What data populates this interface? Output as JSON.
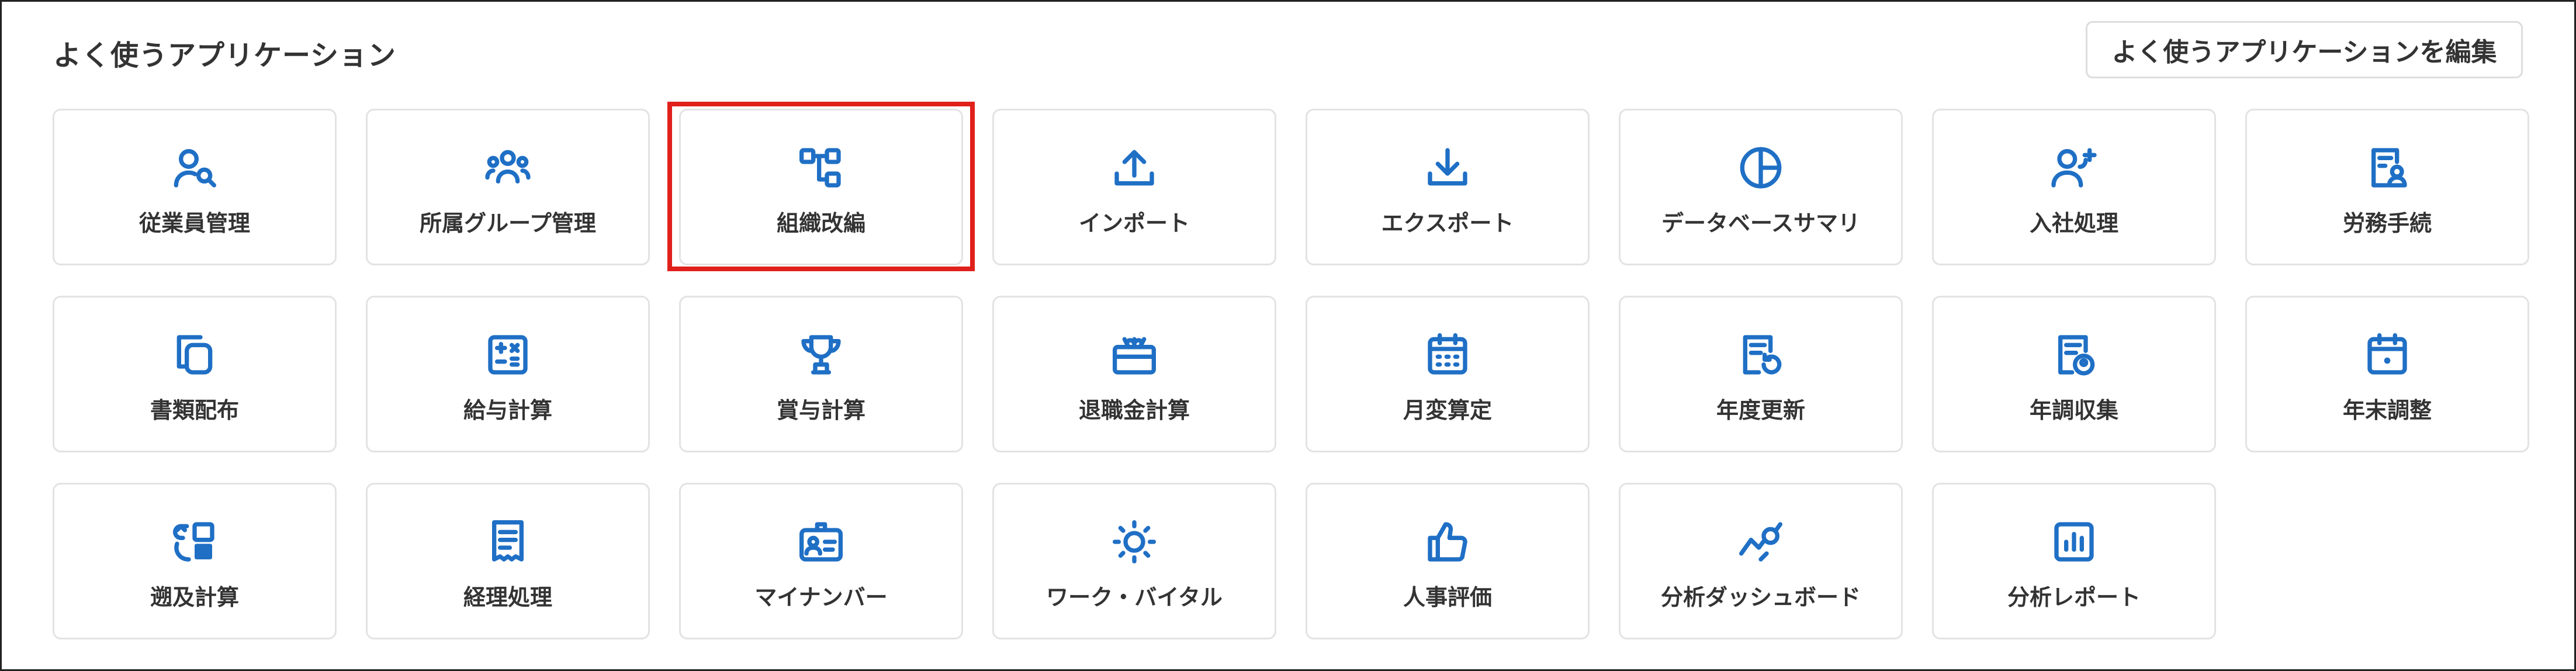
{
  "section": {
    "title": "よく使うアプリケーション",
    "edit_button": "よく使うアプリケーションを編集"
  },
  "theme": {
    "icon_color": "#1f6fc5",
    "highlight_color": "#e0201b"
  },
  "apps": [
    {
      "label": "従業員管理",
      "icon": "user-search-icon"
    },
    {
      "label": "所属グループ管理",
      "icon": "group-icon"
    },
    {
      "label": "組織改編",
      "icon": "org-chart-icon",
      "highlighted": true
    },
    {
      "label": "インポート",
      "icon": "upload-icon"
    },
    {
      "label": "エクスポート",
      "icon": "download-icon"
    },
    {
      "label": "データベースサマリ",
      "icon": "pie-chart-icon"
    },
    {
      "label": "入社処理",
      "icon": "user-add-icon"
    },
    {
      "label": "労務手続",
      "icon": "form-user-icon"
    },
    {
      "label": "書類配布",
      "icon": "documents-icon"
    },
    {
      "label": "給与計算",
      "icon": "calculator-icon"
    },
    {
      "label": "賞与計算",
      "icon": "trophy-icon"
    },
    {
      "label": "退職金計算",
      "icon": "gift-icon"
    },
    {
      "label": "月変算定",
      "icon": "calendar-grid-icon"
    },
    {
      "label": "年度更新",
      "icon": "document-refresh-icon"
    },
    {
      "label": "年調収集",
      "icon": "document-user-icon"
    },
    {
      "label": "年末調整",
      "icon": "calendar-dot-icon"
    },
    {
      "label": "遡及計算",
      "icon": "retroactive-icon"
    },
    {
      "label": "経理処理",
      "icon": "receipt-icon"
    },
    {
      "label": "マイナンバー",
      "icon": "id-card-icon"
    },
    {
      "label": "ワーク・バイタル",
      "icon": "sun-icon"
    },
    {
      "label": "人事評価",
      "icon": "thumbs-up-icon"
    },
    {
      "label": "分析ダッシュボード",
      "icon": "analytics-search-icon"
    },
    {
      "label": "分析レポート",
      "icon": "bar-report-icon"
    }
  ]
}
